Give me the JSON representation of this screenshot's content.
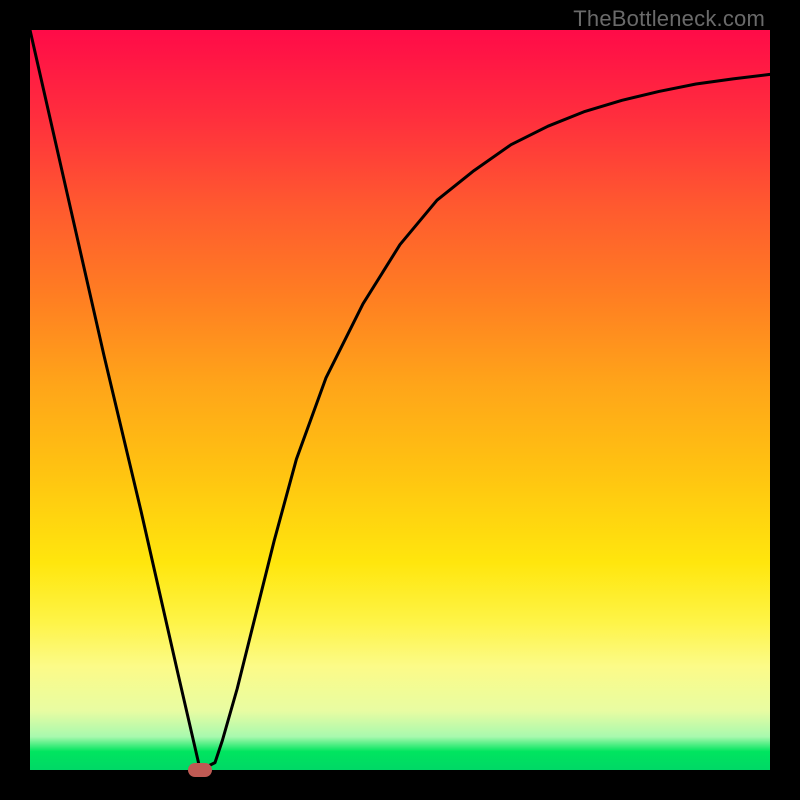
{
  "watermark": "TheBottleneck.com",
  "chart_data": {
    "type": "line",
    "title": "",
    "xlabel": "",
    "ylabel": "",
    "xlim": [
      0,
      100
    ],
    "ylim": [
      0,
      100
    ],
    "grid": false,
    "legend": false,
    "series": [
      {
        "name": "curve",
        "x": [
          0,
          5,
          10,
          15,
          20,
          23,
          25,
          26,
          28,
          30,
          33,
          36,
          40,
          45,
          50,
          55,
          60,
          65,
          70,
          75,
          80,
          85,
          90,
          95,
          100
        ],
        "y": [
          100,
          78,
          56,
          35,
          13,
          0,
          1,
          4,
          11,
          19,
          31,
          42,
          53,
          63,
          71,
          77,
          81,
          84.5,
          87,
          89,
          90.5,
          91.7,
          92.7,
          93.4,
          94
        ]
      }
    ],
    "marker": {
      "x": 23,
      "y": 0,
      "color": "#c05a54"
    },
    "background_gradient": {
      "top": "#ff0b48",
      "bottom": "#00d866"
    }
  }
}
